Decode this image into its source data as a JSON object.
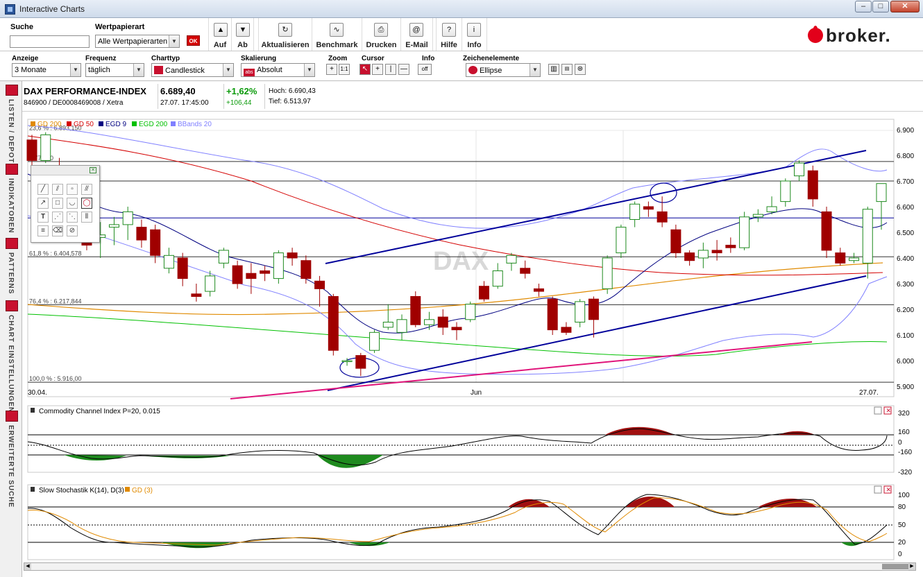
{
  "window": {
    "title": "Interactive Charts",
    "min": "‒",
    "max": "□",
    "close": "✕"
  },
  "toolbar1": {
    "search_label": "Suche",
    "search_value": "",
    "wp_label": "Wertpapierart",
    "wp_value": "Alle Wertpapierarten",
    "ok_label": "OK",
    "tools": [
      {
        "label": "Auf",
        "glyph": "▲"
      },
      {
        "label": "Ab",
        "glyph": "▼"
      },
      {
        "label": "Aktualisieren",
        "glyph": "↻"
      },
      {
        "label": "Benchmark",
        "glyph": "∿"
      },
      {
        "label": "Drucken",
        "glyph": "⎙"
      },
      {
        "label": "E-Mail",
        "glyph": "@"
      },
      {
        "label": "Hilfe",
        "glyph": "?"
      },
      {
        "label": "Info",
        "glyph": "i"
      }
    ],
    "brand": "broker."
  },
  "toolbar2": {
    "anzeige": {
      "label": "Anzeige",
      "value": "3 Monate"
    },
    "frequenz": {
      "label": "Frequenz",
      "value": "täglich"
    },
    "charttyp": {
      "label": "Charttyp",
      "value": "Candlestick"
    },
    "skalierung": {
      "label": "Skalierung",
      "value": "Absolut",
      "icon_text": "abs"
    },
    "zoom": {
      "label": "Zoom",
      "btn1": "+",
      "btn2": "1:1"
    },
    "cursor": {
      "label": "Cursor"
    },
    "info": {
      "label": "Info",
      "btn": "off"
    },
    "zeichen": {
      "label": "Zeichenelemente",
      "value": "Ellipse"
    }
  },
  "lefttabs": [
    "LISTEN / DEPOT",
    "INDIKATOREN",
    "PATTERNS",
    "CHART EINSTELLUNGEN",
    "ERWEITERTE SUCHE"
  ],
  "instrument": {
    "name": "DAX PERFORMANCE-INDEX",
    "ids": "846900 / DE0008469008 / Xetra",
    "price": "6.689,40",
    "datetime": "27.07. 17:45:00",
    "change_pct": "+1,62%",
    "change_abs": "+106,44",
    "high": "Hoch: 6.690,43",
    "low": "Tief: 6.513,97"
  },
  "chart": {
    "watermark": "DAX",
    "legend": [
      {
        "label": "GD 200",
        "color": "#e08a00"
      },
      {
        "label": "GD 50",
        "color": "#d40000"
      },
      {
        "label": "EGD 9",
        "color": "#000080"
      },
      {
        "label": "EGD 200",
        "color": "#00c000"
      },
      {
        "label": "BBands 20",
        "color": "#8080ff"
      }
    ],
    "fib": [
      {
        "label": "23,6 % : 6.893,150",
        "y": 6893.15
      },
      {
        "label": "6.776,00",
        "y": 6776
      },
      {
        "label": "61,8 % : 6.404,578",
        "y": 6404.578
      },
      {
        "label": "76,4 % : 6.217,844",
        "y": 6217.844
      },
      {
        "label": "100,0 % : 5.916,00",
        "y": 5916
      }
    ],
    "hlines": [
      6776,
      6700,
      6556,
      6404.578,
      6217.844,
      5916
    ],
    "yticks": [
      "6.900",
      "6.800",
      "6.700",
      "6.600",
      "6.500",
      "6.400",
      "6.300",
      "6.200",
      "6.100",
      "6.000",
      "5.900"
    ],
    "xlabels": [
      "30.04.",
      "Jun",
      "27.07."
    ],
    "cci": {
      "title": "Commodity Channel Index P=20, 0.015",
      "ticks": [
        "320",
        "160",
        "0",
        "-160",
        "-320"
      ]
    },
    "stoch": {
      "title": "Slow Stochastik K(14), D(3)",
      "title2": "GD (3)",
      "ticks": [
        "100",
        "80",
        "50",
        "20",
        "0"
      ]
    }
  },
  "chart_data": {
    "type": "candlestick",
    "yrange": [
      5900,
      6900
    ],
    "candles": [
      [
        6860,
        6780,
        6880,
        6760
      ],
      [
        6780,
        6880,
        6890,
        6770
      ],
      [
        6760,
        6700,
        6790,
        6680
      ],
      [
        6690,
        6620,
        6720,
        6600
      ],
      [
        6540,
        6450,
        6560,
        6430
      ],
      [
        6480,
        6490,
        6540,
        6400
      ],
      [
        6520,
        6530,
        6560,
        6450
      ],
      [
        6530,
        6580,
        6600,
        6470
      ],
      [
        6520,
        6470,
        6550,
        6440
      ],
      [
        6510,
        6410,
        6530,
        6380
      ],
      [
        6360,
        6410,
        6440,
        6340
      ],
      [
        6400,
        6320,
        6420,
        6290
      ],
      [
        6260,
        6250,
        6300,
        6230
      ],
      [
        6270,
        6330,
        6350,
        6250
      ],
      [
        6380,
        6430,
        6440,
        6360
      ],
      [
        6370,
        6300,
        6390,
        6280
      ],
      [
        6340,
        6320,
        6380,
        6260
      ],
      [
        6350,
        6340,
        6370,
        6310
      ],
      [
        6320,
        6420,
        6430,
        6300
      ],
      [
        6420,
        6400,
        6440,
        6370
      ],
      [
        6390,
        6320,
        6410,
        6300
      ],
      [
        6310,
        6280,
        6330,
        6210
      ],
      [
        6250,
        6040,
        6260,
        6020
      ],
      [
        6000,
        6000,
        6010,
        5980
      ],
      [
        6020,
        5970,
        6030,
        5940
      ],
      [
        6040,
        6110,
        6120,
        6030
      ],
      [
        6130,
        6150,
        6220,
        6120
      ],
      [
        6110,
        6160,
        6180,
        6080
      ],
      [
        6250,
        6140,
        6270,
        6130
      ],
      [
        6140,
        6160,
        6190,
        6120
      ],
      [
        6170,
        6130,
        6200,
        6100
      ],
      [
        6130,
        6120,
        6150,
        6080
      ],
      [
        6160,
        6220,
        6230,
        6150
      ],
      [
        6290,
        6240,
        6310,
        6230
      ],
      [
        6290,
        6350,
        6380,
        6280
      ],
      [
        6380,
        6410,
        6420,
        6350
      ],
      [
        6360,
        6340,
        6390,
        6320
      ],
      [
        6280,
        6270,
        6300,
        6250
      ],
      [
        6240,
        6120,
        6250,
        6100
      ],
      [
        6130,
        6110,
        6150,
        6100
      ],
      [
        6150,
        6230,
        6240,
        6130
      ],
      [
        6240,
        6160,
        6250,
        6090
      ],
      [
        6280,
        6400,
        6410,
        6260
      ],
      [
        6420,
        6520,
        6530,
        6400
      ],
      [
        6550,
        6610,
        6620,
        6520
      ],
      [
        6600,
        6590,
        6620,
        6560
      ],
      [
        6580,
        6540,
        6640,
        6520
      ],
      [
        6510,
        6420,
        6530,
        6400
      ],
      [
        6420,
        6390,
        6430,
        6370
      ],
      [
        6400,
        6430,
        6460,
        6360
      ],
      [
        6430,
        6420,
        6470,
        6390
      ],
      [
        6450,
        6440,
        6480,
        6420
      ],
      [
        6440,
        6560,
        6580,
        6430
      ],
      [
        6560,
        6570,
        6590,
        6540
      ],
      [
        6580,
        6600,
        6640,
        6570
      ],
      [
        6620,
        6700,
        6710,
        6600
      ],
      [
        6720,
        6770,
        6780,
        6700
      ],
      [
        6740,
        6630,
        6760,
        6600
      ],
      [
        6580,
        6430,
        6600,
        6400
      ],
      [
        6420,
        6380,
        6440,
        6370
      ],
      [
        6390,
        6400,
        6420,
        6380
      ],
      [
        6380,
        6590,
        6600,
        6320
      ],
      [
        6620,
        6690,
        6690,
        6510
      ]
    ]
  }
}
